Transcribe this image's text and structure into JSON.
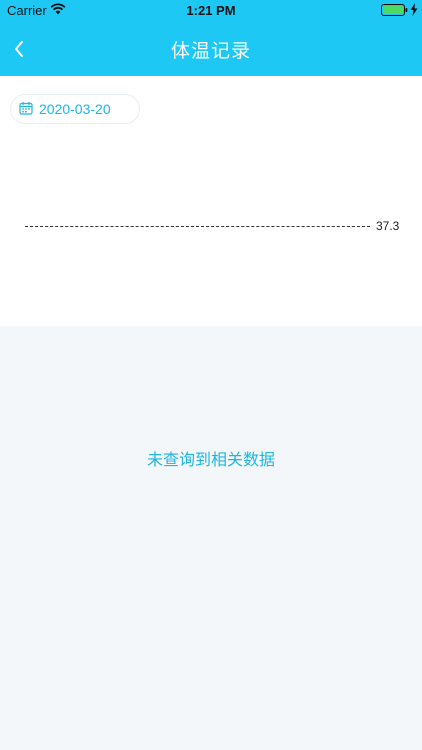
{
  "status_bar": {
    "carrier": "Carrier",
    "time": "1:21 PM"
  },
  "nav": {
    "title": "体温记录",
    "back_icon": "chevron-left-icon"
  },
  "date_filter": {
    "icon": "calendar-icon",
    "value": "2020-03-20"
  },
  "chart": {
    "reference_value": "37.3"
  },
  "empty_state": {
    "message": "未查询到相关数据"
  },
  "colors": {
    "primary": "#1ec8f4",
    "accent_text": "#1eb6e4",
    "background": "#f4f7f9",
    "battery": "#4cd964"
  }
}
